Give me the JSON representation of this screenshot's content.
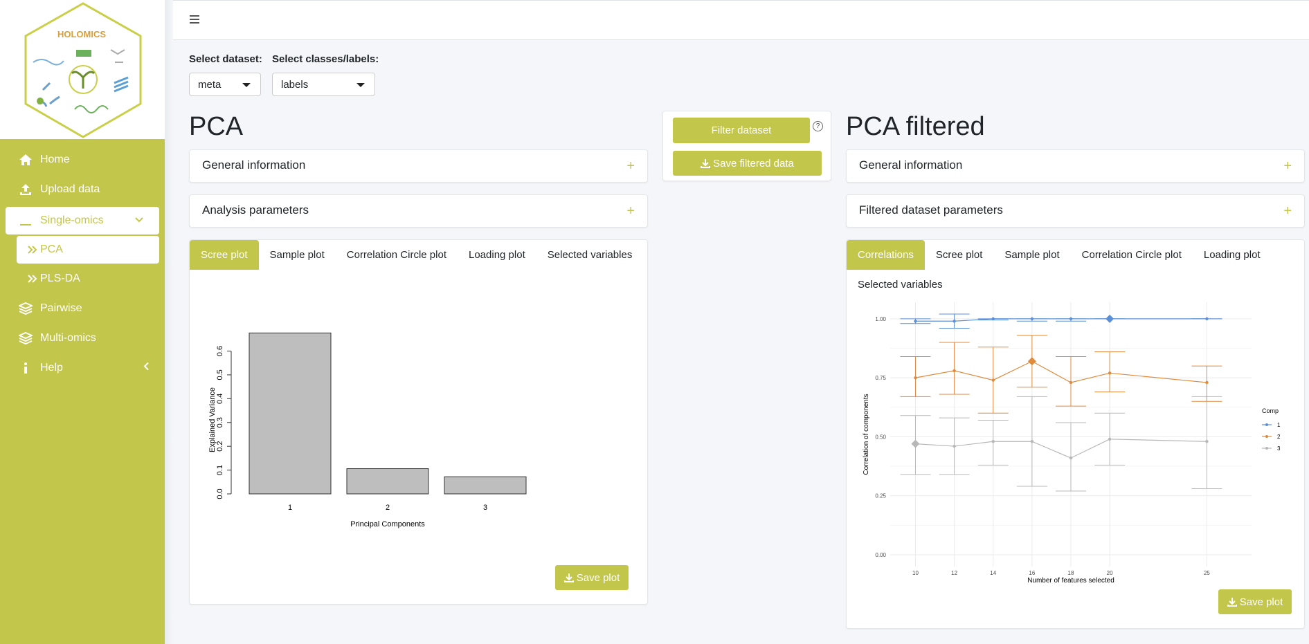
{
  "app": {
    "logo_text": "HOLOMICS"
  },
  "sidebar": {
    "items": [
      {
        "label": "Home",
        "icon": "home-icon"
      },
      {
        "label": "Upload data",
        "icon": "upload-icon"
      },
      {
        "label": "Single-omics",
        "icon": "minus-icon"
      },
      {
        "label": "PCA",
        "icon": "double-chevron-icon"
      },
      {
        "label": "PLS-DA",
        "icon": "double-chevron-icon"
      },
      {
        "label": "Pairwise",
        "icon": "layers-icon"
      },
      {
        "label": "Multi-omics",
        "icon": "layers-icon"
      },
      {
        "label": "Help",
        "icon": "info-icon"
      }
    ]
  },
  "controls": {
    "dataset_label": "Select dataset:",
    "dataset_value": "meta",
    "classes_label": "Select classes/labels:",
    "classes_value": "labels"
  },
  "left_panel": {
    "title": "PCA",
    "accordions": [
      "General information",
      "Analysis parameters"
    ],
    "tabs": [
      "Scree plot",
      "Sample plot",
      "Correlation Circle plot",
      "Loading plot",
      "Selected variables"
    ],
    "save_label": "Save plot"
  },
  "middle_panel": {
    "filter_label": "Filter dataset",
    "help_glyph": "?",
    "save_filtered_label": "Save filtered data"
  },
  "right_panel": {
    "title": "PCA filtered",
    "accordions": [
      "General information",
      "Filtered dataset parameters"
    ],
    "tabs": [
      "Correlations",
      "Scree plot",
      "Sample plot",
      "Correlation Circle plot",
      "Loading plot"
    ],
    "subtitle": "Selected variables",
    "save_label": "Save plot"
  },
  "colors": {
    "accent": "#c2c64a",
    "comp1": "#5b8fd6",
    "comp2": "#e08a3c",
    "comp3": "#b8b8b8"
  },
  "chart_data": [
    {
      "type": "bar",
      "categories": [
        "1",
        "2",
        "3"
      ],
      "values": [
        0.676,
        0.106,
        0.072
      ],
      "xlabel": "Principal Components",
      "ylabel": "Explained Variance",
      "ylim": [
        0,
        0.6
      ],
      "yticks": [
        "0.0",
        "0.1",
        "0.2",
        "0.3",
        "0.4",
        "0.5",
        "0.6"
      ]
    },
    {
      "type": "line",
      "x": [
        10,
        12,
        14,
        16,
        18,
        20,
        25
      ],
      "xlabel": "Number of features selected",
      "ylabel": "Correlation of components",
      "ylim": [
        0,
        1.05
      ],
      "yticks": [
        "0.00",
        "0.25",
        "0.50",
        "0.75",
        "1.00"
      ],
      "legend_title": "Comp",
      "series": [
        {
          "name": "1",
          "values": [
            0.99,
            0.99,
            1.0,
            1.0,
            1.0,
            1.0,
            1.0
          ],
          "err_low": [
            0.98,
            0.96,
            0.995,
            0.99,
            0.99,
            1.0,
            1.0
          ],
          "err_high": [
            1.0,
            1.02,
            1.0,
            1.0,
            1.0,
            1.0,
            1.0
          ],
          "optimal_index": 5
        },
        {
          "name": "2",
          "values": [
            0.75,
            0.78,
            0.74,
            0.82,
            0.73,
            0.77,
            0.73
          ],
          "err_low": [
            0.67,
            0.68,
            0.6,
            0.71,
            0.63,
            0.69,
            0.65
          ],
          "err_high": [
            0.84,
            0.9,
            0.88,
            0.93,
            0.84,
            0.86,
            0.8
          ],
          "optimal_index": 3
        },
        {
          "name": "3",
          "values": [
            0.47,
            0.46,
            0.48,
            0.48,
            0.41,
            0.49,
            0.48
          ],
          "err_low": [
            0.34,
            0.34,
            0.38,
            0.29,
            0.27,
            0.38,
            0.28
          ],
          "err_high": [
            0.59,
            0.58,
            0.57,
            0.67,
            0.56,
            0.6,
            0.67
          ],
          "optimal_index": 0
        }
      ]
    }
  ]
}
